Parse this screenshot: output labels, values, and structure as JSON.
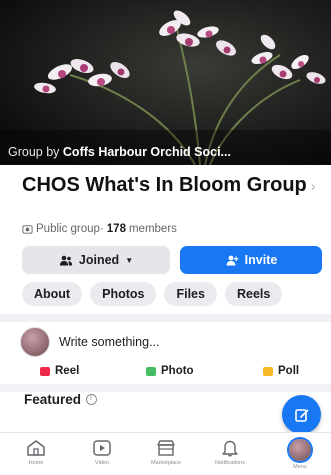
{
  "cover": {
    "caption_prefix": "Group by",
    "caption_owner": "Coffs Harbour Orchid Soci..."
  },
  "group": {
    "title": "CHOS What's In Bloom Group",
    "title_chevron": "›",
    "privacy": "Public group",
    "separator": "·",
    "member_count": "178",
    "member_label": "members"
  },
  "buttons": {
    "joined": "Joined",
    "invite": "Invite"
  },
  "tabs": [
    "About",
    "Photos",
    "Files",
    "Reels"
  ],
  "composer": {
    "placeholder": "Write something..."
  },
  "actions": {
    "reel": "Reel",
    "photo": "Photo",
    "poll": "Poll"
  },
  "featured": {
    "title": "Featured"
  },
  "bottom_nav": {
    "items": [
      "Home",
      "Video",
      "Marketplace",
      "Notifications",
      "Menu"
    ]
  },
  "colors": {
    "accent": "#1877f2",
    "reel_icon": "#f02849",
    "photo_icon": "#45bd62",
    "poll_icon": "#f7b928"
  }
}
